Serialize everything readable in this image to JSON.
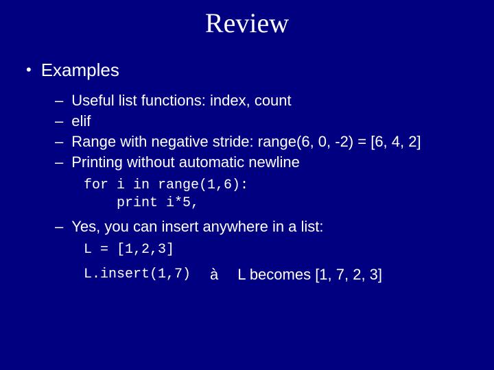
{
  "title": "Review",
  "l1": {
    "bullet": "•",
    "text": "Examples"
  },
  "l2bullet": "–",
  "items": [
    "Useful list functions:  index, count",
    "elif",
    "Range with negative stride:  range(6, 0, -2) = [6, 4, 2]",
    "Printing without automatic newline"
  ],
  "code1_line1": "for i in range(1,6):",
  "code1_line2": "    print i*5,",
  "item5": "Yes, you can insert anywhere in a list:",
  "code2_line1": "L = [1,2,3]",
  "code2_line2": "L.insert(1,7)",
  "arrow": "à",
  "result": "  L becomes [1, 7, 2, 3]"
}
